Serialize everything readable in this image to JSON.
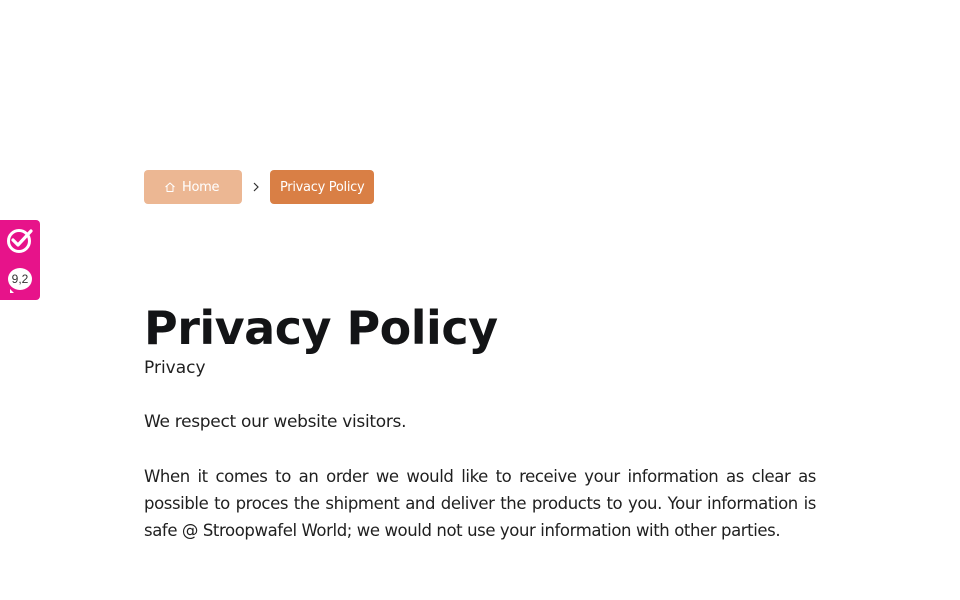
{
  "breadcrumb": {
    "home_label": "Home",
    "current_label": "Privacy Policy"
  },
  "rating_badge": {
    "score": "9,2"
  },
  "content": {
    "title": "Privacy Policy",
    "subtitle": "Privacy",
    "paragraph_1": "We respect our website visitors.",
    "paragraph_2": "When it comes to an order we would like to receive your information as clear as possible to proces the shipment and deliver the products to you. Your information is safe @ Stroopwafel World; we would not use your information with other parties."
  },
  "colors": {
    "home_crumb_bg": "#ecb793",
    "current_crumb_bg": "#d97f45",
    "badge_bg": "#e7138a"
  }
}
